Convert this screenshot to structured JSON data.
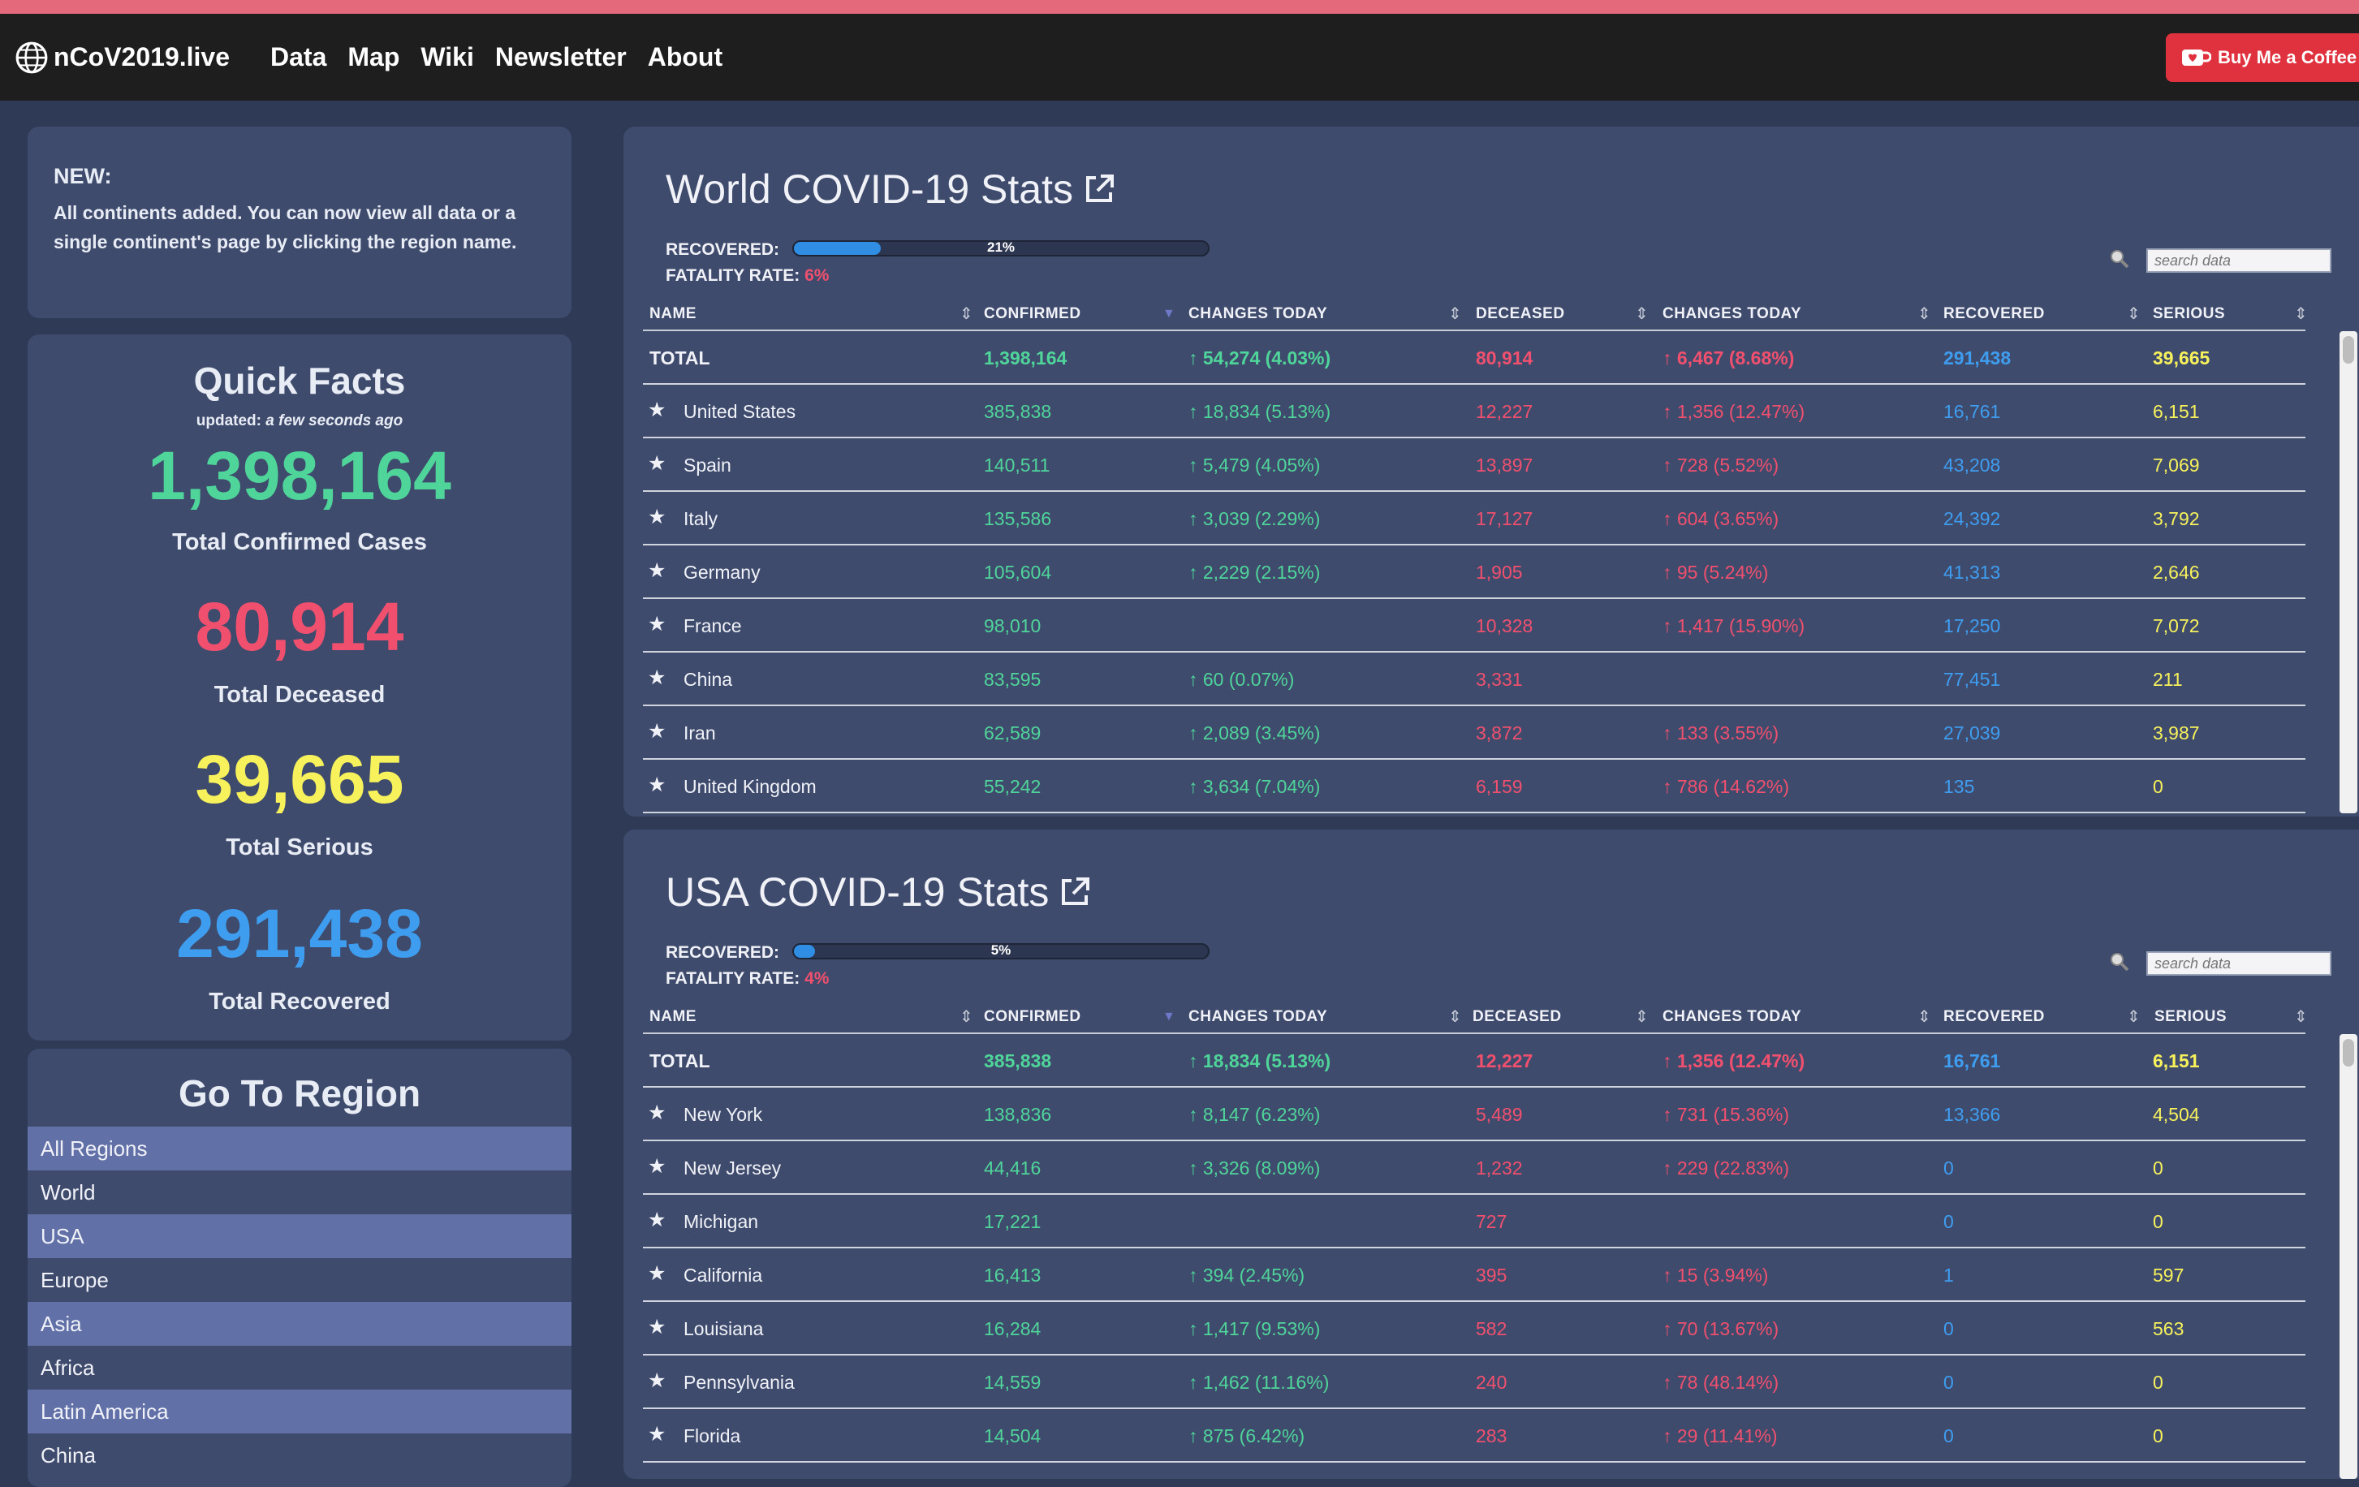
{
  "nav": {
    "brand": "nCoV2019.live",
    "links": [
      "Data",
      "Map",
      "Wiki",
      "Newsletter",
      "About"
    ],
    "coffee": "Buy Me a Coffee"
  },
  "news": {
    "title": "NEW:",
    "body": "All continents added. You can now view all data or a single continent's page by clicking the region name."
  },
  "facts": {
    "title": "Quick Facts",
    "updated_prefix": "updated:",
    "updated_value": "a few seconds ago",
    "confirmed": "1,398,164",
    "confirmed_label": "Total Confirmed Cases",
    "deceased": "80,914",
    "deceased_label": "Total Deceased",
    "serious": "39,665",
    "serious_label": "Total Serious",
    "recovered": "291,438",
    "recovered_label": "Total Recovered"
  },
  "region": {
    "title": "Go To Region",
    "items": [
      "All Regions",
      "World",
      "USA",
      "Europe",
      "Asia",
      "Africa",
      "Latin America",
      "China"
    ]
  },
  "colors": {
    "confirmed": "#4fd49a",
    "deceased": "#f0506e",
    "serious": "#f7f25c",
    "recovered": "#3f9df0",
    "accent_stripe": "#e4697a"
  },
  "world": {
    "title": "World COVID-19 Stats",
    "recovered_label": "RECOVERED:",
    "recovered_pct": "21%",
    "recovered_fraction": 0.21,
    "fatality_label": "FATALITY RATE:",
    "fatality_value": "6%",
    "search_placeholder": "search data",
    "headers": [
      "NAME",
      "CONFIRMED",
      "CHANGES TODAY",
      "DECEASED",
      "CHANGES TODAY",
      "RECOVERED",
      "SERIOUS"
    ],
    "total": {
      "name": "TOTAL",
      "confirmed": "1,398,164",
      "conf_change": "↑ 54,274 (4.03%)",
      "deceased": "80,914",
      "dec_change": "↑ 6,467 (8.68%)",
      "recovered": "291,438",
      "serious": "39,665"
    },
    "rows": [
      {
        "name": "United States",
        "confirmed": "385,838",
        "conf_change": "↑ 18,834 (5.13%)",
        "deceased": "12,227",
        "dec_change": "↑ 1,356 (12.47%)",
        "recovered": "16,761",
        "serious": "6,151"
      },
      {
        "name": "Spain",
        "confirmed": "140,511",
        "conf_change": "↑ 5,479 (4.05%)",
        "deceased": "13,897",
        "dec_change": "↑ 728 (5.52%)",
        "recovered": "43,208",
        "serious": "7,069"
      },
      {
        "name": "Italy",
        "confirmed": "135,586",
        "conf_change": "↑ 3,039 (2.29%)",
        "deceased": "17,127",
        "dec_change": "↑ 604 (3.65%)",
        "recovered": "24,392",
        "serious": "3,792"
      },
      {
        "name": "Germany",
        "confirmed": "105,604",
        "conf_change": "↑ 2,229 (2.15%)",
        "deceased": "1,905",
        "dec_change": "↑ 95 (5.24%)",
        "recovered": "41,313",
        "serious": "2,646"
      },
      {
        "name": "France",
        "confirmed": "98,010",
        "conf_change": "",
        "deceased": "10,328",
        "dec_change": "↑ 1,417 (15.90%)",
        "recovered": "17,250",
        "serious": "7,072"
      },
      {
        "name": "China",
        "confirmed": "83,595",
        "conf_change": "↑ 60 (0.07%)",
        "deceased": "3,331",
        "dec_change": "",
        "recovered": "77,451",
        "serious": "211"
      },
      {
        "name": "Iran",
        "confirmed": "62,589",
        "conf_change": "↑ 2,089 (3.45%)",
        "deceased": "3,872",
        "dec_change": "↑ 133 (3.55%)",
        "recovered": "27,039",
        "serious": "3,987"
      },
      {
        "name": "United Kingdom",
        "confirmed": "55,242",
        "conf_change": "↑ 3,634 (7.04%)",
        "deceased": "6,159",
        "dec_change": "↑ 786 (14.62%)",
        "recovered": "135",
        "serious": "0"
      }
    ]
  },
  "usa": {
    "title": "USA COVID-19 Stats",
    "recovered_label": "RECOVERED:",
    "recovered_pct": "5%",
    "recovered_fraction": 0.05,
    "fatality_label": "FATALITY RATE:",
    "fatality_value": "4%",
    "search_placeholder": "search data",
    "headers": [
      "NAME",
      "CONFIRMED",
      "CHANGES TODAY",
      "DECEASED",
      "CHANGES TODAY",
      "RECOVERED",
      "SERIOUS"
    ],
    "total": {
      "name": "TOTAL",
      "confirmed": "385,838",
      "conf_change": "↑ 18,834 (5.13%)",
      "deceased": "12,227",
      "dec_change": "↑ 1,356 (12.47%)",
      "recovered": "16,761",
      "serious": "6,151"
    },
    "rows": [
      {
        "name": "New York",
        "confirmed": "138,836",
        "conf_change": "↑ 8,147 (6.23%)",
        "deceased": "5,489",
        "dec_change": "↑ 731 (15.36%)",
        "recovered": "13,366",
        "serious": "4,504"
      },
      {
        "name": "New Jersey",
        "confirmed": "44,416",
        "conf_change": "↑ 3,326 (8.09%)",
        "deceased": "1,232",
        "dec_change": "↑ 229 (22.83%)",
        "recovered": "0",
        "serious": "0"
      },
      {
        "name": "Michigan",
        "confirmed": "17,221",
        "conf_change": "",
        "deceased": "727",
        "dec_change": "",
        "recovered": "0",
        "serious": "0"
      },
      {
        "name": "California",
        "confirmed": "16,413",
        "conf_change": "↑ 394 (2.45%)",
        "deceased": "395",
        "dec_change": "↑ 15 (3.94%)",
        "recovered": "1",
        "serious": "597"
      },
      {
        "name": "Louisiana",
        "confirmed": "16,284",
        "conf_change": "↑ 1,417 (9.53%)",
        "deceased": "582",
        "dec_change": "↑ 70 (13.67%)",
        "recovered": "0",
        "serious": "563"
      },
      {
        "name": "Pennsylvania",
        "confirmed": "14,559",
        "conf_change": "↑ 1,462 (11.16%)",
        "deceased": "240",
        "dec_change": "↑ 78 (48.14%)",
        "recovered": "0",
        "serious": "0"
      },
      {
        "name": "Florida",
        "confirmed": "14,504",
        "conf_change": "↑ 875 (6.42%)",
        "deceased": "283",
        "dec_change": "↑ 29 (11.41%)",
        "recovered": "0",
        "serious": "0"
      }
    ]
  }
}
